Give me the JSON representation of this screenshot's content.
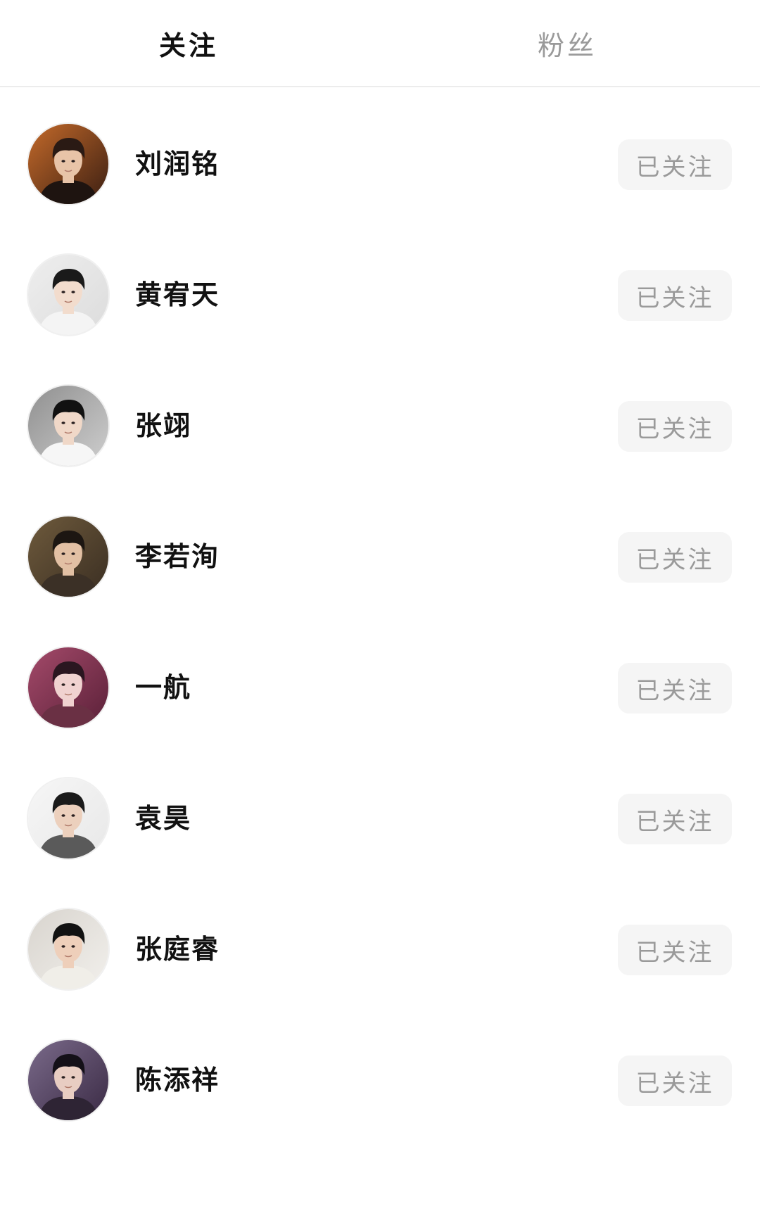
{
  "tabs": [
    {
      "label": "关注",
      "active": true
    },
    {
      "label": "粉丝",
      "active": false
    }
  ],
  "colors": {
    "active_tab": "#111111",
    "inactive_tab": "#9a9a9a",
    "button_bg": "#f5f5f5",
    "button_text": "#9a9a9a",
    "divider": "#ececec"
  },
  "users": [
    {
      "name": "刘润铭",
      "button": "已关注",
      "avatar": {
        "bg": "#c46a2a",
        "bg2": "#3a1e12",
        "hair": "#2a1a14",
        "skin": "#e8c4a8",
        "shirt": "#1e1410"
      }
    },
    {
      "name": "黄宥天",
      "button": "已关注",
      "avatar": {
        "bg": "#eeeeee",
        "bg2": "#dcdcdc",
        "hair": "#1a1a1a",
        "skin": "#f2dccd",
        "shirt": "#f4f4f4"
      }
    },
    {
      "name": "张翊",
      "button": "已关注",
      "avatar": {
        "bg": "#8f8f8f",
        "bg2": "#cfcfcf",
        "hair": "#111111",
        "skin": "#f0d8c8",
        "shirt": "#f6f6f6"
      }
    },
    {
      "name": "李若洵",
      "button": "已关注",
      "avatar": {
        "bg": "#6e5a3c",
        "bg2": "#3a2e22",
        "hair": "#1c1612",
        "skin": "#e2c0a4",
        "shirt": "#3b3026"
      }
    },
    {
      "name": "一航",
      "button": "已关注",
      "avatar": {
        "bg": "#a44a6a",
        "bg2": "#5a2038",
        "hair": "#2a1620",
        "skin": "#f0d2d0",
        "shirt": "#6a3044"
      }
    },
    {
      "name": "袁昊",
      "button": "已关注",
      "avatar": {
        "bg": "#f6f6f6",
        "bg2": "#e8e8e8",
        "hair": "#1a1a1a",
        "skin": "#ecd0bd",
        "shirt": "#5a5a5a"
      }
    },
    {
      "name": "张庭睿",
      "button": "已关注",
      "avatar": {
        "bg": "#d8d4ce",
        "bg2": "#f2f0ec",
        "hair": "#121212",
        "skin": "#eecfba",
        "shirt": "#f0eee8"
      }
    },
    {
      "name": "陈添祥",
      "button": "已关注",
      "avatar": {
        "bg": "#7a6a8a",
        "bg2": "#3a2a44",
        "hair": "#141018",
        "skin": "#e8cdc2",
        "shirt": "#2e2434"
      }
    }
  ]
}
